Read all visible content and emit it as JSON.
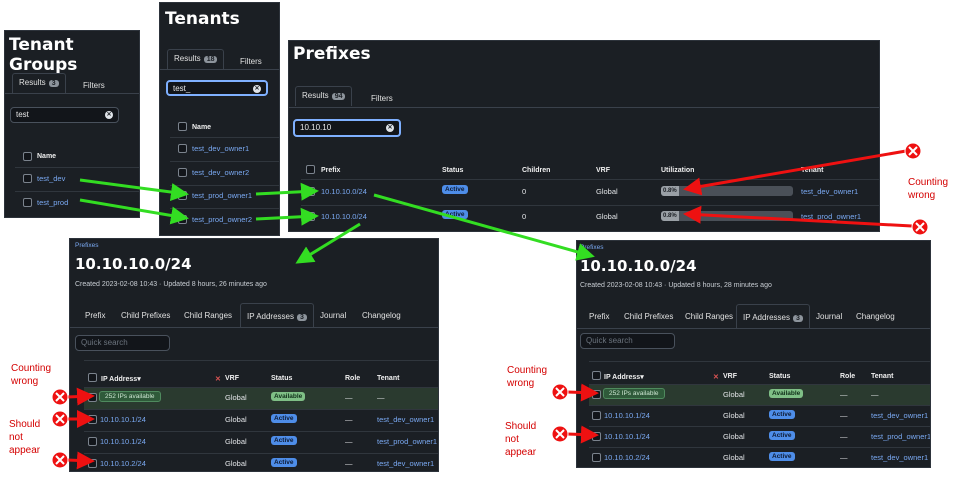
{
  "colors": {
    "panel_bg": "#1b1f24",
    "link": "#7aa9f2",
    "arrow_green": "#33dd22",
    "arrow_red": "#ee1111",
    "active": "#4e8de8",
    "available": "#7fbf86"
  },
  "tenant_groups": {
    "title": "Tenant Groups",
    "tabs": [
      {
        "label": "Results",
        "count": "3"
      },
      {
        "label": "Filters"
      }
    ],
    "search_value": "test",
    "column": "Name",
    "rows": [
      "test_dev",
      "test_prod"
    ]
  },
  "tenants": {
    "title": "Tenants",
    "tabs": [
      {
        "label": "Results",
        "count": "18"
      },
      {
        "label": "Filters"
      }
    ],
    "search_value": "test_",
    "column": "Name",
    "rows": [
      "test_dev_owner1",
      "test_dev_owner2",
      "test_prod_owner1",
      "test_prod_owner2"
    ]
  },
  "prefixes": {
    "title": "Prefixes",
    "tabs": [
      {
        "label": "Results",
        "count": "94"
      },
      {
        "label": "Filters"
      }
    ],
    "search_value": "10.10.10",
    "columns": [
      "Prefix",
      "Status",
      "Children",
      "VRF",
      "Utilization",
      "Tenant"
    ],
    "rows": [
      {
        "prefix": "10.10.10.0/24",
        "status": "Active",
        "children": "0",
        "vrf": "Global",
        "utilization": "0.8%",
        "utilization_value": 0.8,
        "tenant": "test_dev_owner1"
      },
      {
        "prefix": "10.10.10.0/24",
        "status": "Active",
        "children": "0",
        "vrf": "Global",
        "utilization": "0.8%",
        "utilization_value": 0.8,
        "tenant": "test_prod_owner1"
      }
    ]
  },
  "detail_left": {
    "breadcrumb": "Prefixes",
    "title": "10.10.10.0/24",
    "subtitle": "Created 2023-02-08 10:43 · Updated 8 hours, 26 minutes ago",
    "tabs": [
      "Prefix",
      "Child Prefixes",
      "Child Ranges",
      "IP Addresses",
      "Journal",
      "Changelog"
    ],
    "ip_count": "3",
    "quick_search_placeholder": "Quick search",
    "columns": [
      "IP Address",
      "VRF",
      "Status",
      "Role",
      "Tenant"
    ],
    "sort_indicator": "▾",
    "filter_x": "✕",
    "rows": [
      {
        "ip": "252 IPs available",
        "vrf": "Global",
        "status": "Available",
        "role": "—",
        "tenant": "—"
      },
      {
        "ip": "10.10.10.1/24",
        "vrf": "Global",
        "status": "Active",
        "role": "—",
        "tenant": "test_dev_owner1"
      },
      {
        "ip": "10.10.10.1/24",
        "vrf": "Global",
        "status": "Active",
        "role": "—",
        "tenant": "test_prod_owner1"
      },
      {
        "ip": "10.10.10.2/24",
        "vrf": "Global",
        "status": "Active",
        "role": "—",
        "tenant": "test_dev_owner1"
      }
    ]
  },
  "detail_right": {
    "breadcrumb": "Prefixes",
    "title": "10.10.10.0/24",
    "subtitle": "Created 2023-02-08 10:43 · Updated 8 hours, 28 minutes ago",
    "tabs": [
      "Prefix",
      "Child Prefixes",
      "Child Ranges",
      "IP Addresses",
      "Journal",
      "Changelog"
    ],
    "ip_count": "3",
    "quick_search_placeholder": "Quick search",
    "columns": [
      "IP Address",
      "VRF",
      "Status",
      "Role",
      "Tenant"
    ],
    "sort_indicator": "▾",
    "filter_x": "✕",
    "rows": [
      {
        "ip": "252 IPs available",
        "vrf": "Global",
        "status": "Available",
        "role": "—",
        "tenant": "—"
      },
      {
        "ip": "10.10.10.1/24",
        "vrf": "Global",
        "status": "Active",
        "role": "—",
        "tenant": "test_dev_owner1"
      },
      {
        "ip": "10.10.10.1/24",
        "vrf": "Global",
        "status": "Active",
        "role": "—",
        "tenant": "test_prod_owner1"
      },
      {
        "ip": "10.10.10.2/24",
        "vrf": "Global",
        "status": "Active",
        "role": "—",
        "tenant": "test_dev_owner1"
      }
    ]
  },
  "annotations": {
    "counting_wrong_top": "Counting\nwrong",
    "counting_wrong_left": "Counting\nwrong",
    "should_not_appear_left": "Should\nnot\nappear",
    "counting_wrong_right": "Counting\nwrong",
    "should_not_appear_right": "Should\nnot\nappear",
    "x_mark": "✕"
  }
}
